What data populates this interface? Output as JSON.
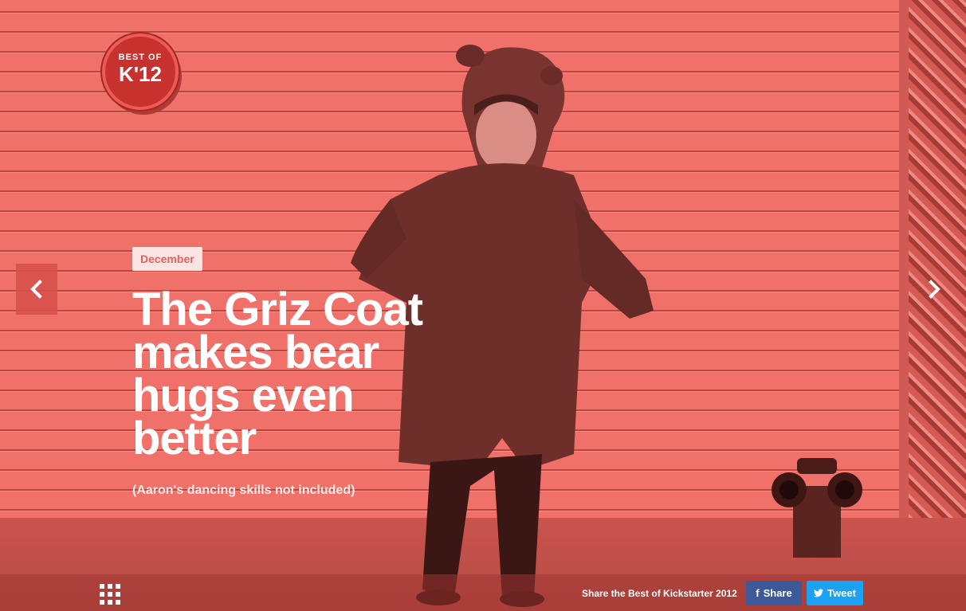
{
  "badge": {
    "line1": "BEST OF",
    "line2": "K'12"
  },
  "slide": {
    "month": "December",
    "headline": "The Griz Coat makes bear hugs even better",
    "subhead": "(Aaron's dancing skills not included)"
  },
  "nav": {
    "prev_icon": "chevron-left-icon",
    "next_icon": "chevron-right-icon"
  },
  "footer": {
    "grid_icon": "grid-icon",
    "share_text": "Share the Best of Kickstarter 2012",
    "facebook_label": "Share",
    "twitter_label": "Tweet"
  },
  "colors": {
    "overlay": "#e2625b",
    "facebook": "#3c5a99",
    "twitter": "#1da1f2",
    "badge": "#c8322e"
  }
}
